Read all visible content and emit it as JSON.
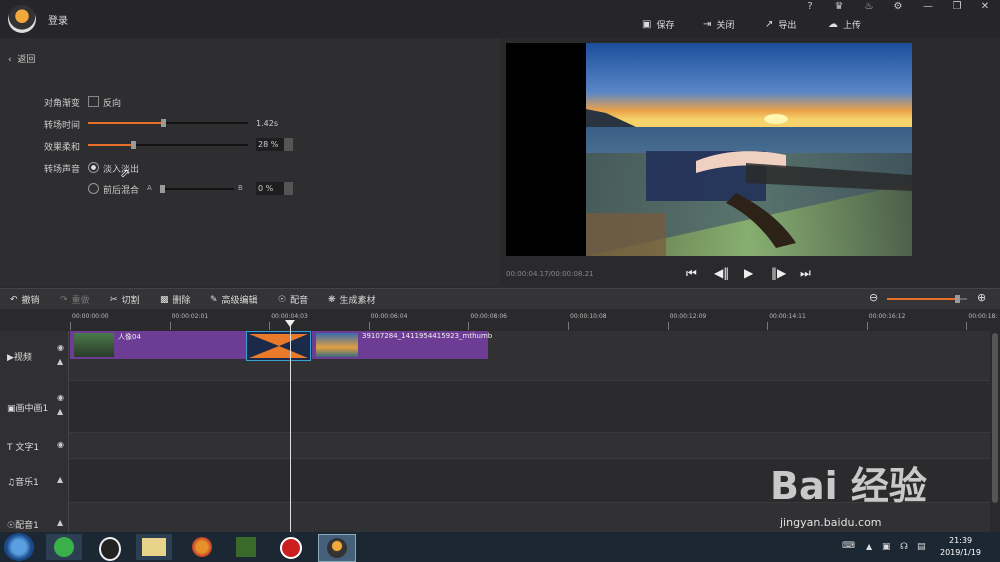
{
  "titlebar": {
    "login": "登录",
    "actions": [
      {
        "icon": "save-icon",
        "glyph": "💾",
        "label": "保存"
      },
      {
        "icon": "close-door-icon",
        "glyph": "⇥",
        "label": "关闭"
      },
      {
        "icon": "export-icon",
        "glyph": "↗",
        "label": "导出"
      },
      {
        "icon": "upload-icon",
        "glyph": "☁",
        "label": "上传"
      }
    ],
    "window_icons": [
      {
        "icon": "help-icon",
        "glyph": "?"
      },
      {
        "icon": "vip-crown-icon",
        "glyph": "♛"
      },
      {
        "icon": "bell-icon",
        "glyph": "🔔"
      },
      {
        "icon": "settings-gear-icon",
        "glyph": "⚙"
      },
      {
        "icon": "minimize-icon",
        "glyph": "—"
      },
      {
        "icon": "restore-icon",
        "glyph": "❐"
      },
      {
        "icon": "close-icon",
        "glyph": "✕"
      }
    ]
  },
  "panel": {
    "back": "返回",
    "diagonal_label": "对角渐变",
    "reverse_label": "反向",
    "duration_label": "转场时间",
    "duration_value": "1.42s",
    "duration_fraction": 0.47,
    "softness_label": "效果柔和",
    "softness_value": "28 %",
    "softness_fraction": 0.28,
    "sound_label": "转场声音",
    "fade_label": "淡入淡出",
    "mix_label": "前后混合",
    "mix_a": "A",
    "mix_b": "B",
    "mix_value": "0 %"
  },
  "preview": {
    "timecode": "00:00:04.17/00:00:08.21"
  },
  "toolbar": {
    "items": [
      {
        "icon": "undo-icon",
        "glyph": "↶",
        "label": "撤销",
        "enabled": true
      },
      {
        "icon": "redo-icon",
        "glyph": "↷",
        "label": "重做",
        "enabled": false
      },
      {
        "icon": "cut-icon",
        "glyph": "✂",
        "label": "切割",
        "enabled": true
      },
      {
        "icon": "delete-icon",
        "glyph": "🗑",
        "label": "删除",
        "enabled": true
      },
      {
        "icon": "advanced-edit-icon",
        "glyph": "✎",
        "label": "高级编辑",
        "enabled": true
      },
      {
        "icon": "dub-mic-icon",
        "glyph": "🎤",
        "label": "配音",
        "enabled": true
      },
      {
        "icon": "generate-material-icon",
        "glyph": "⚙",
        "label": "生成素材",
        "enabled": true
      }
    ],
    "zoom_fraction": 0.88
  },
  "ruler": {
    "ticks": [
      "00:00:00:00",
      "00:00:02:01",
      "00:00:04:03",
      "00:00:06:04",
      "00:00:08:06",
      "00:00:10:08",
      "00:00:12:09",
      "00:00:14:11",
      "00:00:16:12",
      "00:00:18:"
    ]
  },
  "tracks": [
    {
      "icon": "video-track-icon",
      "glyph": "▶",
      "label": "视频"
    },
    {
      "icon": "pip-track-icon",
      "glyph": "▣",
      "label": "画中画1"
    },
    {
      "icon": "text-track-icon",
      "glyph": "T",
      "label": "文字1"
    },
    {
      "icon": "music-track-icon",
      "glyph": "♫",
      "label": "音乐1"
    },
    {
      "icon": "dub-track-icon",
      "glyph": "🎤",
      "label": "配音1"
    }
  ],
  "clips": {
    "clip1_label": "人像04",
    "clip2_label": "39107284_1411954415923_mthumb"
  },
  "taskbar": {
    "time": "21:39",
    "date": "2019/1/19"
  },
  "watermark": {
    "brand": "Bai 经验",
    "url": "jingyan.baidu.com"
  }
}
